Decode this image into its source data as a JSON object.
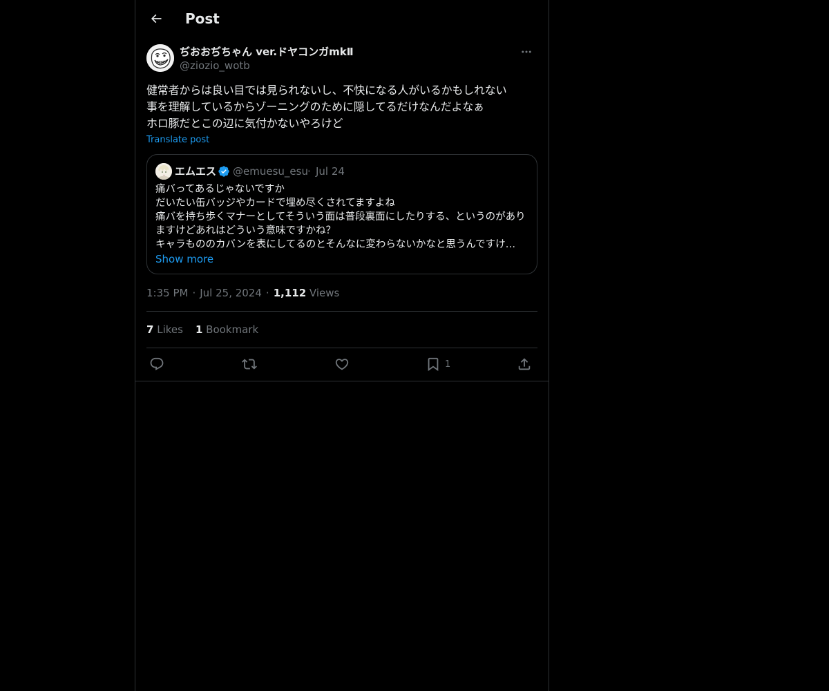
{
  "header": {
    "back_icon": "arrow-left-icon",
    "title": "Post"
  },
  "post": {
    "author_name": "ぢおおぢちゃん ver.ドヤコンガmkⅡ",
    "author_handle": "@ziozio_wotb",
    "more_icon": "more-dots-icon",
    "text": "健常者からは良い目では見られないし、不快になる人がいるかもしれない\n事を理解しているからゾーニングのために隠してるだけなんだよなぁ\nホロ豚だとこの辺に気付かないやろけど",
    "translate_label": "Translate post",
    "time": "1:35 PM",
    "date": "Jul 25, 2024",
    "views_count": "1,112",
    "views_label": "Views",
    "separator": "·"
  },
  "quote": {
    "name": "エムエス",
    "verified_icon": "verified-badge-icon",
    "handle": "@emuesu_esu",
    "separator": "·",
    "date": "Jul 24",
    "text": "痛バってあるじゃないですか\nだいたい缶バッジやカードで埋め尽くされてますよね\n痛バを持ち歩くマナーとしてそういう面は普段裏面にしたりする、というのがありますけどあれはどういう意味ですかね？\nキャラもののカバンを表にしてるのとそんなに変わらないかなと思うんですけ…",
    "show_more": "Show more"
  },
  "stats": {
    "likes_count": "7",
    "likes_label": "Likes",
    "bookmarks_count": "1",
    "bookmarks_label": "Bookmark"
  },
  "actions": {
    "reply_icon": "reply-icon",
    "repost_icon": "repost-icon",
    "like_icon": "heart-icon",
    "bookmark_icon": "bookmark-icon",
    "bookmark_count": "1",
    "share_icon": "share-icon"
  },
  "colors": {
    "background": "#000000",
    "text": "#e7e9ea",
    "secondary": "#71767b",
    "accent": "#1d9bf0",
    "border": "#2f3336"
  }
}
